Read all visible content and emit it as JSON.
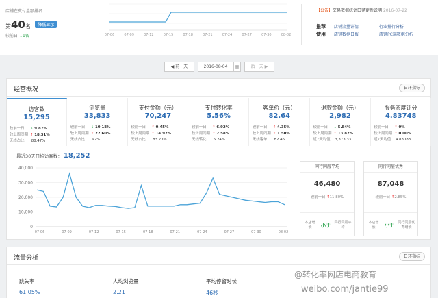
{
  "header": {
    "rank_title": "店铺在支付金额排名",
    "rank_prefix": "第",
    "rank_number": "40",
    "rank_suffix": "名",
    "rank_badge": "降低显示",
    "rank_sub_label": "较前日",
    "rank_sub_value": "↓1名",
    "mini_chart_ticks": [
      "07-06",
      "07-09",
      "07-12",
      "07-15",
      "07-18",
      "07-21",
      "07-24",
      "07-27",
      "07-30",
      "08-02"
    ]
  },
  "notice": {
    "tag": "【公告】",
    "text": "交易数据统计口径更新说明",
    "date": "2016-07-22"
  },
  "recommend": {
    "label": "推荐使用",
    "links": [
      [
        "店铺流量详情",
        "行业排行分析"
      ],
      [
        "店铺数据日报",
        "店铺PC端数据分析"
      ]
    ]
  },
  "datenav": {
    "prev": "◀ 前一天",
    "date": "2016-08-04",
    "next": "后一天 ▶",
    "calendar_icon": "calendar-icon"
  },
  "overview": {
    "title": "经营概况",
    "button": "日环指标",
    "metrics": [
      {
        "name": "访客数",
        "value": "15,295",
        "rows": [
          [
            "较前一日",
            "↓",
            "9.87%",
            "dn"
          ],
          [
            "较上周同期",
            "↑",
            "18.31%",
            "up"
          ],
          [
            "无线占比",
            "",
            "88.47%",
            ""
          ]
        ]
      },
      {
        "name": "浏览量",
        "value": "33,833",
        "rows": [
          [
            "较前一日",
            "↓",
            "10.18%",
            "dn"
          ],
          [
            "较上周同期",
            "↑",
            "22.60%",
            "up"
          ],
          [
            "无线占比",
            "",
            "92%",
            ""
          ]
        ]
      },
      {
        "name": "支付金额（元）",
        "value": "70,247",
        "rows": [
          [
            "较前一日",
            "↑",
            "0.45%",
            "up"
          ],
          [
            "较上周同期",
            "↑",
            "14.92%",
            "up"
          ],
          [
            "无线占比",
            "",
            "83.23%",
            ""
          ]
        ]
      },
      {
        "name": "支付转化率",
        "value": "5.56%",
        "rows": [
          [
            "较前一日",
            "↑",
            "6.92%",
            "up"
          ],
          [
            "较上周同期",
            "↑",
            "2.58%",
            "up"
          ],
          [
            "无线转化",
            "",
            "5.24%",
            ""
          ]
        ]
      },
      {
        "name": "客单价（元）",
        "value": "82.64",
        "rows": [
          [
            "较前一日",
            "↑",
            "4.35%",
            "up"
          ],
          [
            "较上周同期",
            "↑",
            "1.50%",
            "up"
          ],
          [
            "无线客单",
            "",
            "82.46",
            ""
          ]
        ]
      },
      {
        "name": "退款金额（元）",
        "value": "2,982",
        "rows": [
          [
            "较前一日",
            "↓",
            "5.84%",
            "dn"
          ],
          [
            "较上周同期",
            "↑",
            "13.82%",
            "up"
          ],
          [
            "近7天均值",
            "",
            "3,373.33",
            ""
          ]
        ]
      },
      {
        "name": "服务态度评分",
        "value": "4.83748",
        "rows": [
          [
            "较前一日",
            "↑",
            "0%",
            "up"
          ],
          [
            "较上周同期",
            "↑",
            "0.00%",
            "up"
          ],
          [
            "近7天均值",
            "",
            "4.83083",
            ""
          ]
        ]
      }
    ],
    "avg_label": "最近30天日均访客数：",
    "avg_value": "18,252",
    "cards": [
      {
        "title": "同行同层平均",
        "value": "46,480",
        "change_label": "较前一日",
        "arrow": "↑",
        "change": "11.80%",
        "foot_left": "本店增长",
        "foot_mid": "小于",
        "foot_right": "同行同层平均"
      },
      {
        "title": "同行同层优秀",
        "value": "87,048",
        "change_label": "较前一日",
        "arrow": "↑",
        "change": "2.85%",
        "foot_left": "本店增长",
        "foot_mid": "小于",
        "foot_right": "同行同层优秀增长"
      }
    ]
  },
  "chart_data": {
    "type": "line",
    "x": [
      "07-06",
      "07-09",
      "07-12",
      "07-15",
      "07-18",
      "07-21",
      "07-24",
      "07-27",
      "07-30",
      "08-02"
    ],
    "y_ticks": [
      "40,000",
      "30,000",
      "20,000",
      "10,000",
      "0"
    ],
    "ylim": [
      0,
      40000
    ],
    "values": [
      25000,
      24000,
      14000,
      13500,
      20000,
      36000,
      20000,
      14000,
      13000,
      14500,
      14500,
      14000,
      13800,
      13000,
      12500,
      13000,
      28000,
      14000,
      14000,
      14000,
      14000,
      14000,
      15000,
      15000,
      15500,
      16000,
      23000,
      33000,
      22000,
      21000,
      20000,
      19000,
      18000,
      17500,
      17000,
      16500,
      17000,
      17000,
      15000
    ]
  },
  "traffic": {
    "title": "流量分析",
    "button": "日环指标",
    "metrics": [
      {
        "name": "跳失率",
        "value": "61.05%"
      },
      {
        "name": "人均浏览量",
        "value": "2.21"
      },
      {
        "name": "平均停留时长",
        "value": "46秒"
      }
    ]
  },
  "watermark": {
    "line1": "@转化率网店电商教育",
    "line2": "weibo.com/jantie99"
  }
}
